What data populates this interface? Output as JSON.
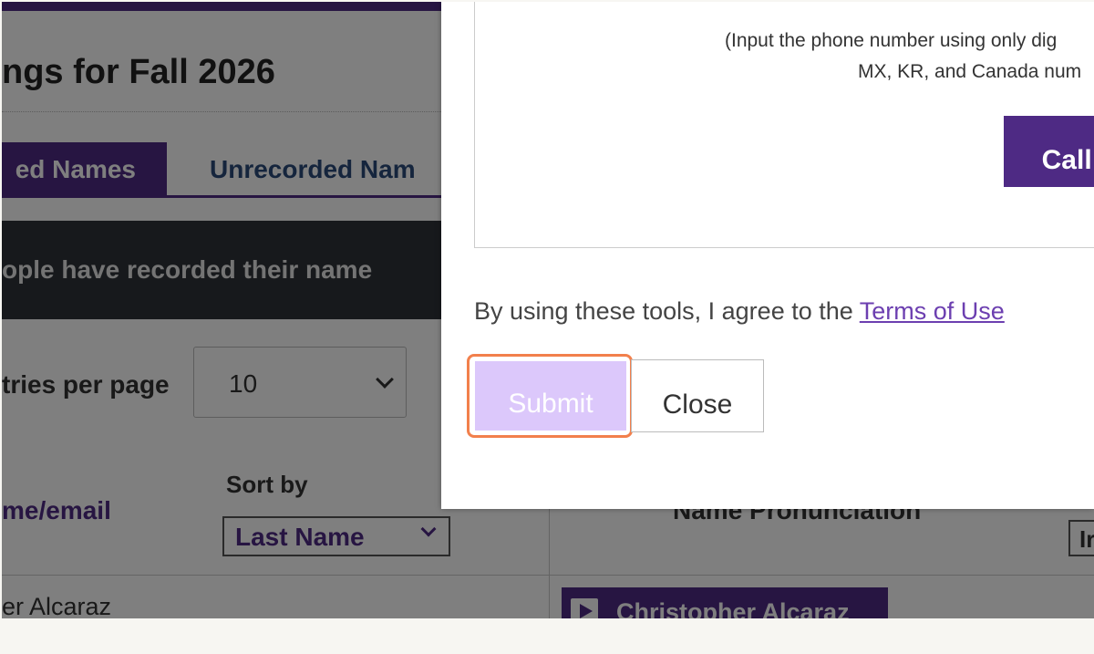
{
  "background": {
    "page_title": "ngs for Fall 2026",
    "tabs": [
      {
        "label": "ed Names",
        "active": true
      },
      {
        "label": "Unrecorded Nam",
        "active": false
      }
    ],
    "info_bar_text": "ople have recorded their name",
    "entries": {
      "label": "tries per page",
      "selected": "10"
    },
    "table": {
      "name_header": "me/email",
      "sort": {
        "label": "Sort by",
        "selected": "Last Name"
      },
      "pronunciation_header": "Name Pronunciation",
      "right_box_text": "Ir",
      "rows": [
        {
          "name": "er Alcaraz",
          "pronunciation": "Christopher Alcaraz"
        }
      ]
    }
  },
  "modal": {
    "hint_line1": "(Input the phone number using only dig",
    "hint_line2": "MX, KR, and Canada num",
    "call_button": "Call me",
    "terms_prefix": "By using these tools, I agree to the ",
    "terms_link": "Terms of Use",
    "submit_label": "Submit",
    "close_label": "Close"
  },
  "colors": {
    "brand_purple": "#4e2a84",
    "submit_disabled": "#dcc8fb",
    "highlight_orange": "#f2804c",
    "link_purple": "#6c3fb0"
  }
}
